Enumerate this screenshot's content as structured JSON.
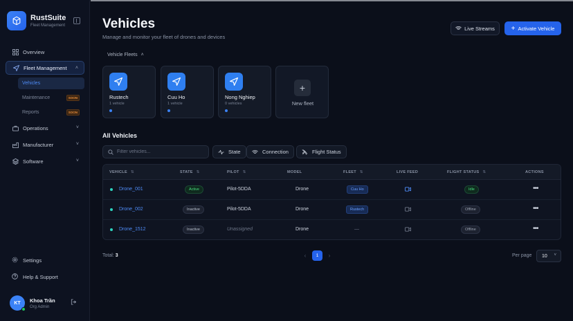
{
  "brand": {
    "name": "RustSuite",
    "subtitle": "Fleet Management"
  },
  "sidebar": {
    "items": [
      {
        "label": "Overview",
        "icon": "grid-icon"
      },
      {
        "label": "Fleet Management",
        "icon": "send-icon",
        "expanded": true
      },
      {
        "label": "Operations",
        "icon": "briefcase-icon"
      },
      {
        "label": "Manufacturer",
        "icon": "factory-icon"
      },
      {
        "label": "Software",
        "icon": "layers-icon"
      }
    ],
    "sub_items": [
      {
        "label": "Vehicles"
      },
      {
        "label": "Maintenance",
        "badge": "SOON"
      },
      {
        "label": "Reports",
        "badge": "SOON"
      }
    ],
    "footer": [
      {
        "label": "Settings",
        "icon": "gear-icon"
      },
      {
        "label": "Help & Support",
        "icon": "help-icon"
      }
    ],
    "user": {
      "initials": "KT",
      "name": "Khoa Trần",
      "role": "Org Admin"
    }
  },
  "header": {
    "title": "Vehicles",
    "subtitle": "Manage and monitor your fleet of drones and devices",
    "live_streams_label": "Live Streams",
    "activate_label": "Activate Vehicle"
  },
  "fleets": {
    "toggle_label": "Vehicle Fleets",
    "cards": [
      {
        "name": "Rustech",
        "count": "1 vehicle"
      },
      {
        "name": "Cuu Ho",
        "count": "1 vehicle"
      },
      {
        "name": "Nong Nghiep",
        "count": "0 vehicles"
      }
    ],
    "new_label": "New fleet"
  },
  "vehicles": {
    "section_title": "All Vehicles",
    "search_placeholder": "Filter vehicles...",
    "filters": {
      "state": "State",
      "connection": "Connection",
      "flight_status": "Flight Status"
    },
    "columns": {
      "vehicle": "VEHICLE",
      "state": "STATE",
      "pilot": "PILOT",
      "model": "MODEL",
      "fleet": "FLEET",
      "live_feed": "LIVE FEED",
      "flight_status": "FLIGHT STATUS",
      "actions": "ACTIONS"
    },
    "rows": [
      {
        "vehicle": "Drone_001",
        "state": "Active",
        "pilot": "Pilot-5DDA",
        "model": "Drone",
        "fleet": "Cuu Ho",
        "flight_status": "Idle"
      },
      {
        "vehicle": "Drone_002",
        "state": "Inactive",
        "pilot": "Pilot-5DDA",
        "model": "Drone",
        "fleet": "Rustech",
        "flight_status": "Offline"
      },
      {
        "vehicle": "Drone_1512",
        "state": "Inactive",
        "pilot": "Unassigned",
        "model": "Drone",
        "fleet": "—",
        "flight_status": "Offline"
      }
    ],
    "actions_glyph": "•••"
  },
  "pagination": {
    "total_label": "Total:",
    "total": "3",
    "current_page": "1",
    "per_page_label": "Per page",
    "per_page": "10"
  },
  "colors": {
    "accent": "#2563eb",
    "active": "#4ade80",
    "link": "#4f8cf7",
    "soon": "#e88c3a"
  }
}
